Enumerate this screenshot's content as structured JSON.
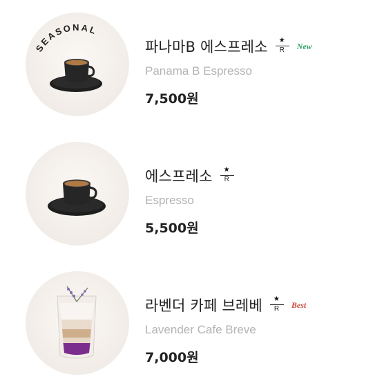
{
  "products": [
    {
      "name_ko": "파나마B 에스프레소",
      "name_en": "Panama B Espresso",
      "price": "7,500원",
      "reserve_mark": "R",
      "badge": "New",
      "image_label": "SEASONAL",
      "image_alt": "espresso-cup"
    },
    {
      "name_ko": "에스프레소",
      "name_en": "Espresso",
      "price": "5,500원",
      "reserve_mark": "R",
      "badge": "",
      "image_alt": "espresso-cup"
    },
    {
      "name_ko": "라벤더 카페 브레베",
      "name_en": "Lavender Cafe Breve",
      "price": "7,000원",
      "reserve_mark": "R",
      "badge": "Best",
      "image_alt": "lavender-latte-glass"
    }
  ],
  "colors": {
    "badge_new": "#2e9e6a",
    "badge_best": "#c94a3c",
    "english_name": "#b3b3b3",
    "text": "#222222"
  }
}
